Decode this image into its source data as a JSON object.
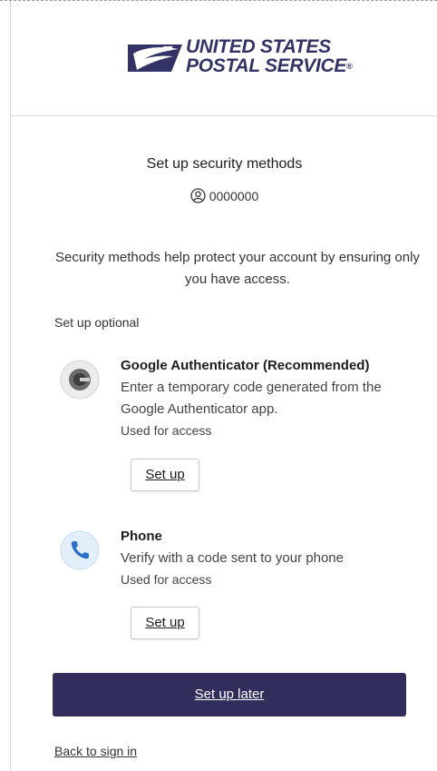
{
  "brand": {
    "line1": "UNITED STATES",
    "line2": "POSTAL SERVICE",
    "reg_mark": "®",
    "color": "#333366"
  },
  "page": {
    "title": "Set up security methods",
    "username": "0000000",
    "intro": "Security methods help protect your account by ensuring only you have access.",
    "section_label": "Set up optional"
  },
  "methods": [
    {
      "name": "Google Authenticator (Recommended)",
      "description": "Enter a temporary code generated from the Google Authenticator app.",
      "usage": "Used for access",
      "button": "Set up",
      "icon": "google-authenticator-icon"
    },
    {
      "name": "Phone",
      "description": "Verify with a code sent to your phone",
      "usage": "Used for access",
      "button": "Set up",
      "icon": "phone-icon"
    }
  ],
  "actions": {
    "later": "Set up later",
    "back": "Back to sign in",
    "primary_color": "#322e5b"
  }
}
